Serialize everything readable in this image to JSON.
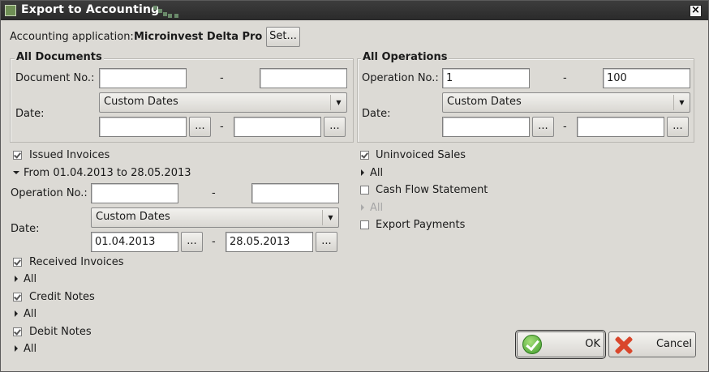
{
  "window": {
    "title": "Export to Accounting"
  },
  "accounting": {
    "label": "Accounting application:",
    "app_name": "Microinvest Delta Pro",
    "set_button": "Set..."
  },
  "all_documents": {
    "title": "All Documents",
    "doc_no_label": "Document No.:",
    "doc_no_from": "",
    "doc_no_to": "",
    "date_label": "Date:",
    "date_mode": "Custom Dates",
    "date_from": "",
    "date_to": ""
  },
  "all_operations": {
    "title": "All Operations",
    "op_no_label": "Operation No.:",
    "op_no_from": "1",
    "op_no_to": "100",
    "date_label": "Date:",
    "date_mode": "Custom Dates",
    "date_from": "",
    "date_to": ""
  },
  "issued_invoices": {
    "label": "Issued Invoices",
    "checked": true,
    "expander_label": "From 01.04.2013 to 28.05.2013",
    "op_no_label": "Operation No.:",
    "op_no_from": "",
    "op_no_to": "",
    "date_label": "Date:",
    "date_mode": "Custom Dates",
    "date_from": "01.04.2013",
    "date_to": "28.05.2013"
  },
  "received_invoices": {
    "label": "Received Invoices",
    "checked": true,
    "expander_label": "All"
  },
  "credit_notes": {
    "label": "Credit Notes",
    "checked": true,
    "expander_label": "All"
  },
  "debit_notes": {
    "label": "Debit Notes",
    "checked": true,
    "expander_label": "All"
  },
  "uninvoiced_sales": {
    "label": "Uninvoiced Sales",
    "checked": true,
    "expander_label": "All"
  },
  "cash_flow": {
    "label": "Cash Flow Statement",
    "checked": false,
    "expander_label": "All"
  },
  "export_payments": {
    "label": "Export Payments",
    "checked": false
  },
  "common": {
    "dash": "-",
    "ellipsis": "...",
    "dropdown_arrow": "▼"
  },
  "footer": {
    "ok_label": "OK",
    "cancel_label": "Cancel"
  }
}
